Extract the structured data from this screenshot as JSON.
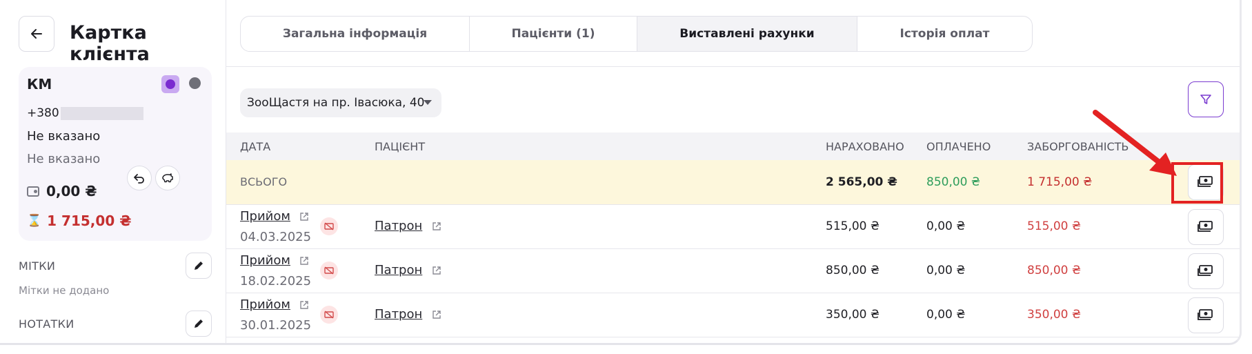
{
  "page_title": "Картка клієнта",
  "client": {
    "name": "КМ",
    "phone_prefix": "+380",
    "field_1": "Не вказано",
    "field_2": "Не вказано",
    "balance": "0,00 ₴",
    "debt": "1 715,00 ₴"
  },
  "sections": {
    "tags_label": "МІТКИ",
    "tags_empty": "Мітки не додано",
    "notes_label": "НОТАТКИ"
  },
  "tabs": [
    {
      "label": "Загальна інформація"
    },
    {
      "label": "Пацієнти (1)"
    },
    {
      "label": "Виставлені рахунки"
    },
    {
      "label": "Історія оплат"
    }
  ],
  "clinic_select": {
    "value": "ЗооЩастя на пр. Івасюка, 40"
  },
  "table": {
    "headers": {
      "date": "ДАТА",
      "patient": "ПАЦІЄНТ",
      "charged": "НАРАХОВАНО",
      "paid": "ОПЛАЧЕНО",
      "debt": "ЗАБОРГОВАНІСТЬ"
    },
    "total": {
      "label": "ВСЬОГО",
      "charged": "2 565,00 ₴",
      "paid": "850,00 ₴",
      "debt": "1 715,00 ₴"
    },
    "rows": [
      {
        "type": "Прийом",
        "date": "04.03.2025",
        "patient": "Патрон",
        "charged": "515,00 ₴",
        "paid": "0,00 ₴",
        "debt": "515,00 ₴"
      },
      {
        "type": "Прийом",
        "date": "18.02.2025",
        "patient": "Патрон",
        "charged": "850,00 ₴",
        "paid": "0,00 ₴",
        "debt": "850,00 ₴"
      },
      {
        "type": "Прийом",
        "date": "30.01.2025",
        "patient": "Патрон",
        "charged": "350,00 ₴",
        "paid": "0,00 ₴",
        "debt": "350,00 ₴"
      }
    ]
  },
  "colors": {
    "accent": "#7a3bd0",
    "paid_green": "#2e9d5b",
    "debt_red": "#c42f2f",
    "total_bg": "#fdf7dc",
    "annotation_red": "#e32222"
  }
}
